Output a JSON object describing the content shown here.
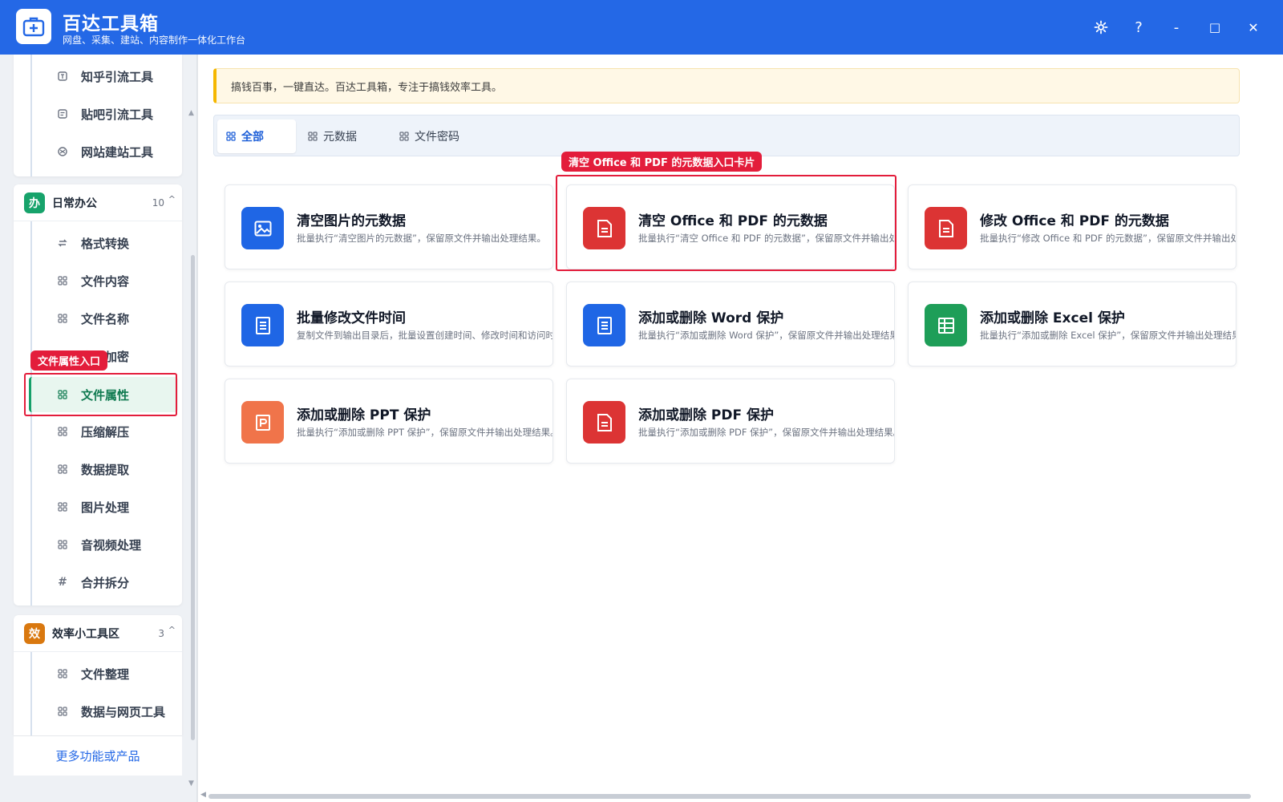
{
  "app": {
    "title": "百达工具箱",
    "subtitle": "网盘、采集、建站、内容制作一体化工作台",
    "logo_icon": "toolbox-plus-icon",
    "accent": "#2468e6"
  },
  "window_controls": {
    "settings": "⚙",
    "help": "?",
    "minimize": "-",
    "maximize": "□",
    "close": "✕"
  },
  "sidebar": {
    "top_items": [
      {
        "label": "知乎引流工具",
        "icon": "zhihu-icon"
      },
      {
        "label": "贴吧引流工具",
        "icon": "tieba-icon"
      },
      {
        "label": "网站建站工具",
        "icon": "globe-icon"
      }
    ],
    "group_office": {
      "badge": "办",
      "badge_color": "#17a36b",
      "title": "日常办公",
      "count": "10",
      "caret": "^",
      "items": [
        {
          "label": "格式转换",
          "icon": "swap-icon"
        },
        {
          "label": "文件内容",
          "icon": "grid-icon"
        },
        {
          "label": "文件名称",
          "icon": "grid-icon"
        },
        {
          "label": "文件加密",
          "icon": "grid-icon"
        },
        {
          "label": "文件属性",
          "icon": "grid-icon"
        },
        {
          "label": "压缩解压",
          "icon": "grid-icon"
        },
        {
          "label": "数据提取",
          "icon": "grid-icon"
        },
        {
          "label": "图片处理",
          "icon": "grid-icon"
        },
        {
          "label": "音视频处理",
          "icon": "grid-icon"
        },
        {
          "label": "合并拆分",
          "icon": "hash-icon"
        }
      ],
      "active_index": 4
    },
    "group_efficiency": {
      "badge": "效",
      "badge_color": "#d9780f",
      "title": "效率小工具区",
      "count": "3",
      "caret": "^",
      "items": [
        {
          "label": "文件整理",
          "icon": "grid-icon"
        },
        {
          "label": "数据与网页工具",
          "icon": "grid-icon"
        }
      ]
    },
    "more_link": "更多功能或产品"
  },
  "callouts": {
    "sidebar": "文件属性入口",
    "card": "清空 Office 和 PDF 的元数据入口卡片",
    "color": "#e31d3b"
  },
  "main": {
    "notice": "搞钱百事，一键直达。百达工具箱，专注于搞钱效率工具。",
    "tabs": [
      {
        "label": "全部",
        "active": true
      },
      {
        "label": "元数据",
        "active": false
      },
      {
        "label": "文件密码",
        "active": false
      }
    ],
    "cards": [
      {
        "title": "清空图片的元数据",
        "desc": "批量执行“清空图片的元数据”，保留原文件并输出处理结果。",
        "icon": "image-icon",
        "color": "#1f66e5"
      },
      {
        "title": "清空 Office 和 PDF 的元数据",
        "desc": "批量执行“清空 Office 和 PDF 的元数据”，保留原文件并输出处理结果。",
        "icon": "document-icon",
        "color": "#dc3434"
      },
      {
        "title": "修改 Office 和 PDF 的元数据",
        "desc": "批量执行“修改 Office 和 PDF 的元数据”，保留原文件并输出处理结果。",
        "icon": "document-icon",
        "color": "#dc3434"
      },
      {
        "title": "批量修改文件时间",
        "desc": "复制文件到输出目录后，批量设置创建时间、修改时间和访问时间。",
        "icon": "document-lines-icon",
        "color": "#1f66e5"
      },
      {
        "title": "添加或删除 Word 保护",
        "desc": "批量执行“添加或删除 Word 保护”，保留原文件并输出处理结果。",
        "icon": "word-doc-icon",
        "color": "#1f66e5"
      },
      {
        "title": "添加或删除 Excel 保护",
        "desc": "批量执行“添加或删除 Excel 保护”，保留原文件并输出处理结果。",
        "icon": "spreadsheet-icon",
        "color": "#1e9e58"
      },
      {
        "title": "添加或删除 PPT 保护",
        "desc": "批量执行“添加或删除 PPT 保护”，保留原文件并输出处理结果。",
        "icon": "presentation-icon",
        "color": "#f0744a"
      },
      {
        "title": "添加或删除 PDF 保护",
        "desc": "批量执行“添加或删除 PDF 保护”，保留原文件并输出处理结果。",
        "icon": "pdf-doc-icon",
        "color": "#dc3434"
      }
    ]
  }
}
